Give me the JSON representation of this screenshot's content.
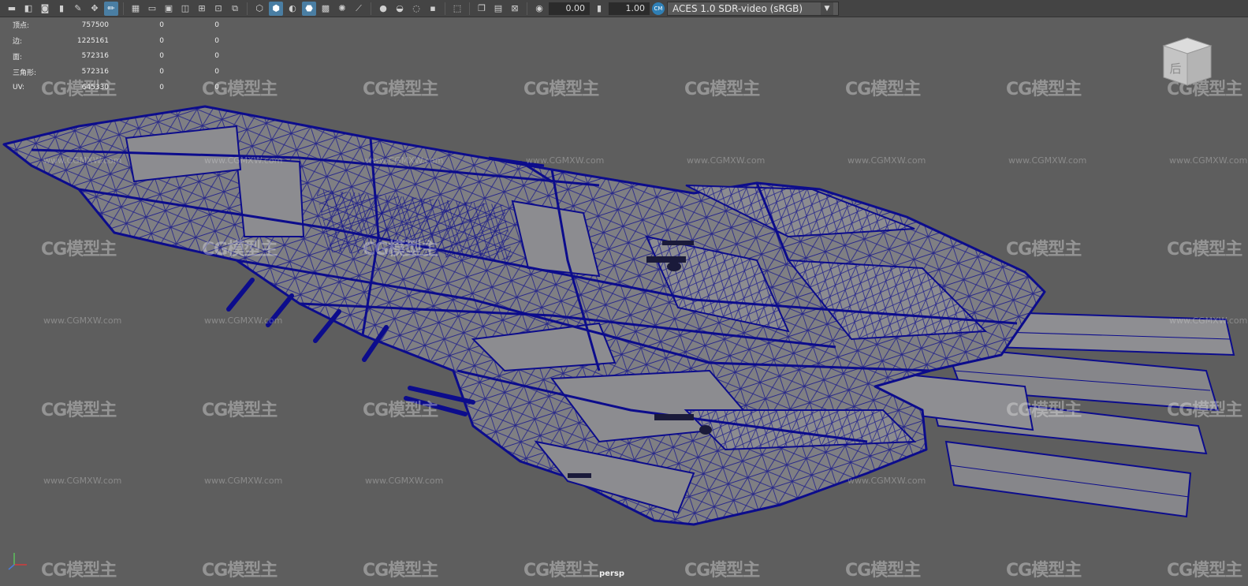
{
  "toolbar": {
    "exposure_value": "0.00",
    "gamma_value": "1.00",
    "color_space": "ACES 1.0 SDR-video (sRGB)",
    "icons": [
      "camera-select-icon",
      "camera-attributes-icon",
      "bookmark-icon",
      "image-plane-icon",
      "grease-pencil-icon",
      "grid-icon",
      "film-gate-icon",
      "resolution-gate-icon",
      "gate-mask-icon",
      "field-chart-icon",
      "safe-action-icon",
      "safe-title-icon",
      "wireframe-icon",
      "smooth-shade-icon",
      "use-default-material-icon",
      "wireframe-on-shaded-icon",
      "textured-icon",
      "use-all-lights-icon",
      "shadows-icon",
      "screen-space-ao-icon",
      "motion-blur-icon",
      "multisample-aa-icon",
      "depth-of-field-icon",
      "isolate-select-icon",
      "xray-icon",
      "xray-active-components-icon",
      "xray-joints-icon",
      "exposure-icon",
      "gamma-icon",
      "color-management-icon"
    ]
  },
  "hud": {
    "rows": [
      {
        "label": "顶点:",
        "value": "757500",
        "c1": "0",
        "c2": "0"
      },
      {
        "label": "边:",
        "value": "1225161",
        "c1": "0",
        "c2": "0"
      },
      {
        "label": "面:",
        "value": "572316",
        "c1": "0",
        "c2": "0"
      },
      {
        "label": "三角形:",
        "value": "572316",
        "c1": "0",
        "c2": "0"
      },
      {
        "label": "UV:",
        "value": "645330",
        "c1": "0",
        "c2": "0"
      }
    ]
  },
  "viewcube": {
    "face_label": "后"
  },
  "watermark": {
    "logo": "CG模型主",
    "url": "www.CGMXW.com"
  },
  "viewport": {
    "camera": "persp"
  },
  "colors": {
    "wire": "#0c0c8c",
    "viewport_bg": "#5e5e5e",
    "model_fill": "#8a8a8e"
  }
}
